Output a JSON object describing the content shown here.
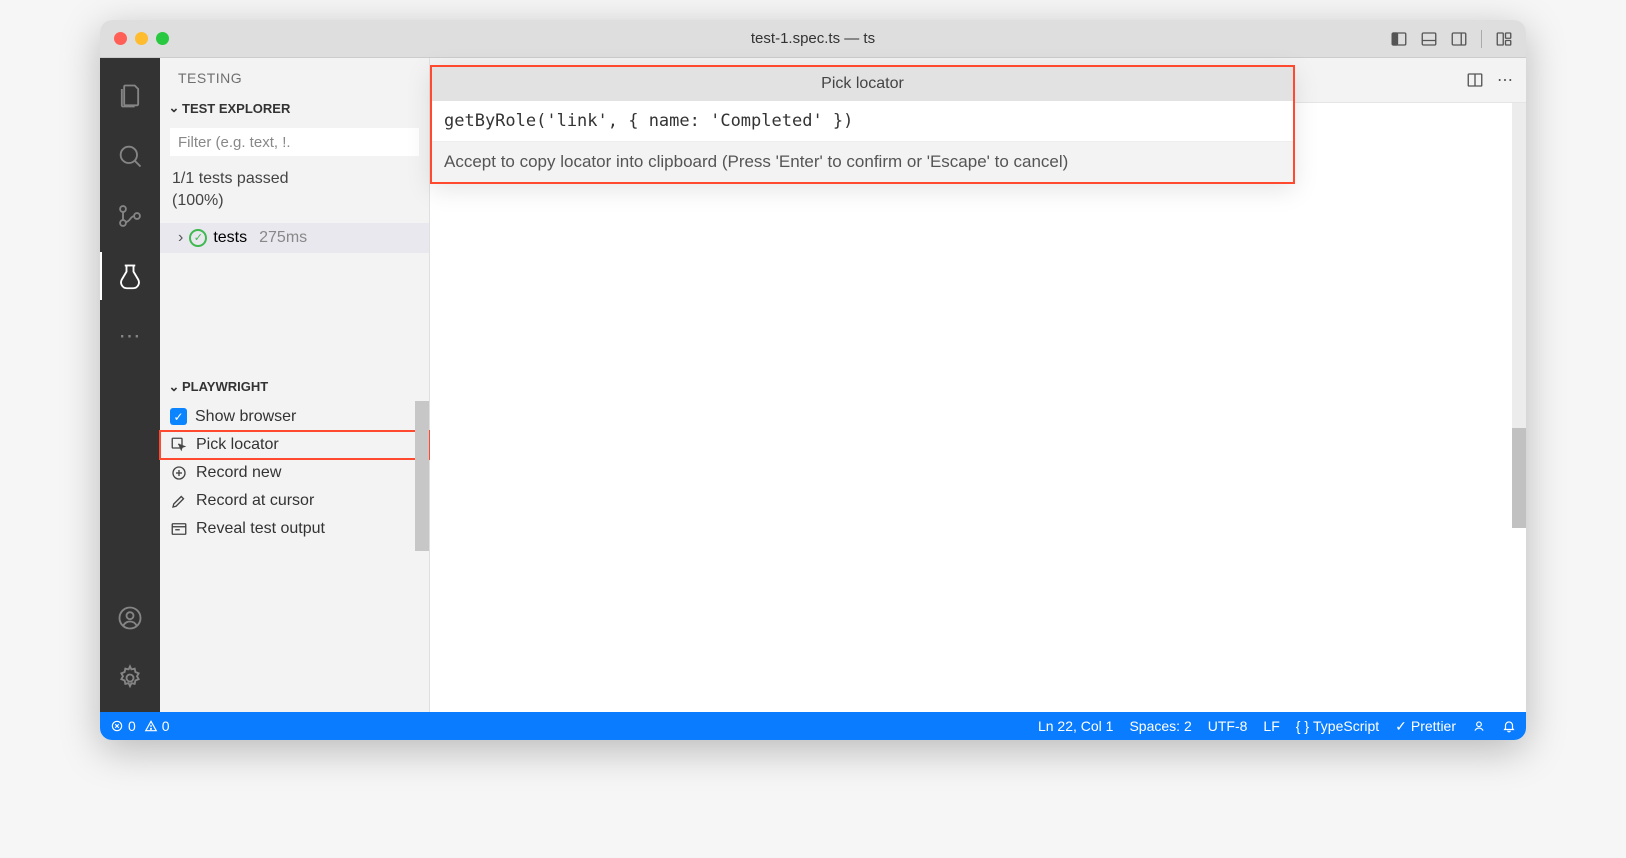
{
  "window": {
    "title": "test-1.spec.ts — ts"
  },
  "sidebar": {
    "title": "TESTING",
    "explorer_label": "TEST EXPLORER",
    "filter_placeholder": "Filter (e.g. text, !.",
    "tests_status_line1": "1/1 tests passed",
    "tests_status_line2": "(100%)",
    "test_name": "tests",
    "test_duration": "275ms",
    "playwright_label": "PLAYWRIGHT",
    "playwright_items": [
      {
        "label": "Show browser"
      },
      {
        "label": "Pick locator"
      },
      {
        "label": "Record new"
      },
      {
        "label": "Record at cursor"
      },
      {
        "label": "Reveal test output"
      }
    ]
  },
  "quick_input": {
    "title": "Pick locator",
    "value": "getByRole('link', { name: 'Completed' })",
    "hint": "Accept to copy locator into clipboard (Press 'Enter' to confirm or 'Escape' to cancel)"
  },
  "statusbar": {
    "errors": "0",
    "warnings": "0",
    "cursor": "Ln 22, Col 1",
    "spaces": "Spaces: 2",
    "encoding": "UTF-8",
    "eol": "LF",
    "language": "TypeScript",
    "prettier": "Prettier"
  }
}
